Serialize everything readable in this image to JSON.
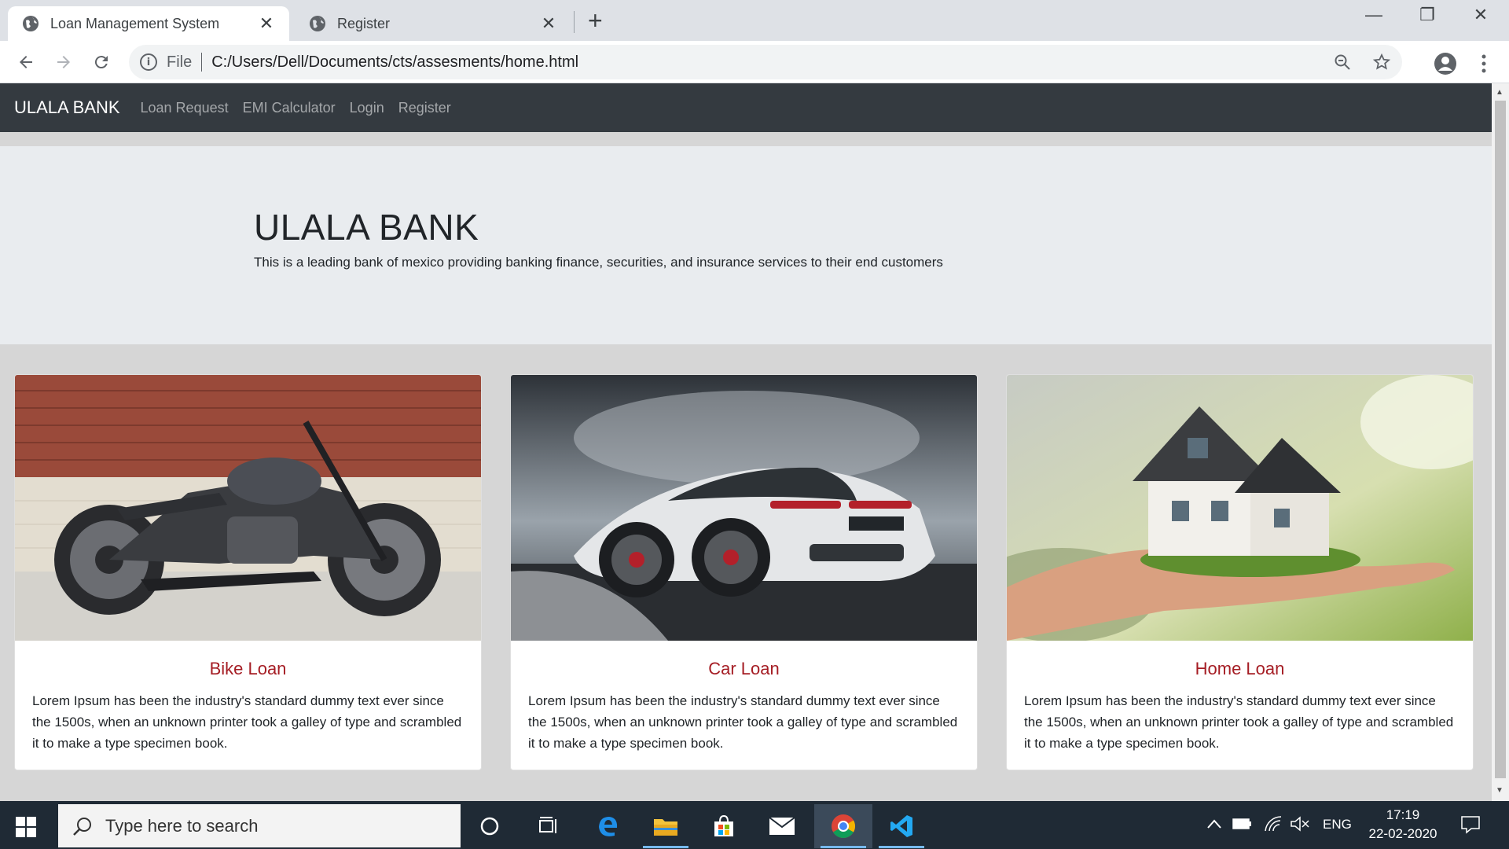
{
  "browser": {
    "tabs": [
      {
        "label": "Loan Management System",
        "close": "✕"
      },
      {
        "label": "Register",
        "close": "✕"
      }
    ],
    "new_tab": "+",
    "window_controls": {
      "minimize": "—",
      "restore": "❐",
      "close": "✕"
    },
    "address": {
      "scheme_label": "File",
      "url": "C:/Users/Dell/Documents/cts/assesments/home.html"
    }
  },
  "site": {
    "brand": "ULALA BANK",
    "nav": [
      "Loan Request",
      "EMI Calculator",
      "Login",
      "Register"
    ],
    "hero": {
      "title": "ULALA BANK",
      "subtitle": "This is a leading bank of mexico providing banking finance, securities, and insurance services to their end customers"
    },
    "cards": [
      {
        "title": "Bike Loan",
        "text": "Lorem Ipsum has been the industry's standard dummy text ever since the 1500s, when an unknown printer took a galley of type and scrambled it to make a type specimen book.",
        "image": "motorcycle-photo"
      },
      {
        "title": "Car Loan",
        "text": "Lorem Ipsum has been the industry's standard dummy text ever since the 1500s, when an unknown printer took a galley of type and scrambled it to make a type specimen book.",
        "image": "sports-car-photo"
      },
      {
        "title": "Home Loan",
        "text": "Lorem Ipsum has been the industry's standard dummy text ever since the 1500s, when an unknown printer took a galley of type and scrambled it to make a type specimen book.",
        "image": "house-in-hand-photo"
      }
    ],
    "colors": {
      "navbar": "#343a40",
      "card_title": "#a51d24",
      "jumbotron": "#e9ecef"
    }
  },
  "taskbar": {
    "search_placeholder": "Type here to search",
    "lang": "ENG",
    "time": "17:19",
    "date": "22-02-2020"
  }
}
